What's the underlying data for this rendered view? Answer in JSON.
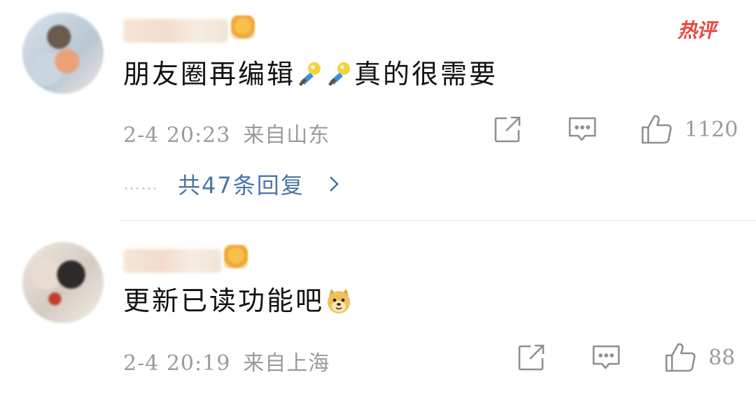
{
  "comments": [
    {
      "hot_label": "热评",
      "text": "朋友圈再编辑",
      "text_suffix": "真的很需要",
      "emoji_1": "like-bulb-emoji",
      "emoji_2": "like-bulb-emoji",
      "time": "2-4  20:23",
      "location": "来自山东",
      "likes": "1120",
      "replies_dots": "……",
      "replies_label": "共47条回复"
    },
    {
      "text": "更新已读功能吧",
      "emoji": "doge-emoji",
      "time": "2-4  20:19",
      "location": "来自上海",
      "likes": "88"
    }
  ],
  "colors": {
    "link": "#4a75a8",
    "hot": "#e8483d",
    "meta": "#9b9b9b",
    "text": "#111111"
  },
  "icons": {
    "share": "share-icon",
    "comment": "comment-icon",
    "like": "thumbs-up-icon",
    "reply_chevron": "chevron-right-icon"
  }
}
